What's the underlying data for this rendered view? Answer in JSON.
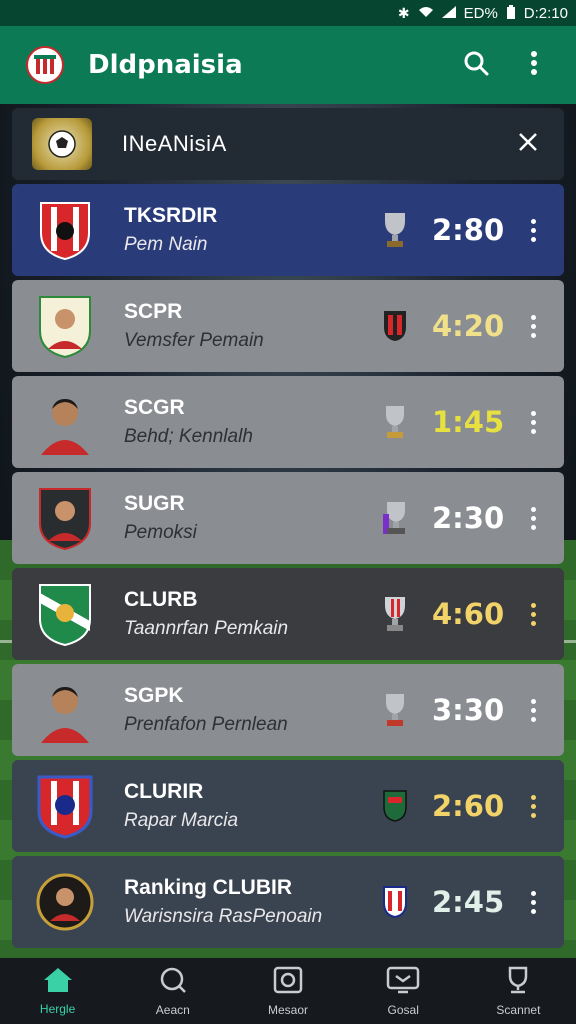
{
  "status_bar": {
    "indicator": "ED%",
    "time": "D:2:10",
    "icons": [
      "bluetooth-icon",
      "wifi-icon",
      "signal-icon",
      "battery-icon"
    ]
  },
  "app_bar": {
    "title": "Dldpnaisia",
    "actions": [
      "search-icon",
      "more-vertical-icon"
    ]
  },
  "header": {
    "title": "INeANisiA",
    "close_icon": "close-icon"
  },
  "list": [
    {
      "title": "TKSRDIR",
      "subtitle": "Pem Nain",
      "time": "2:80",
      "theme": "blue",
      "time_color": "#ffffff"
    },
    {
      "title": "SCPR",
      "subtitle": "Vemsfer Pemain",
      "time": "4:20",
      "theme": "gray",
      "time_color": "#f0e08a"
    },
    {
      "title": "SCGR",
      "subtitle": "Behd; Kennlalh",
      "time": "1:45",
      "theme": "gray",
      "time_color": "#e6e040"
    },
    {
      "title": "SUGR",
      "subtitle": "Pemoksi",
      "time": "2:30",
      "theme": "gray",
      "time_color": "#ffffff"
    },
    {
      "title": "CLURB",
      "subtitle": "Taannrfan Pemkain",
      "time": "4:60",
      "theme": "dark",
      "time_color": "#f2d36a"
    },
    {
      "title": "SGPK",
      "subtitle": "Prenfafon Pernlean",
      "time": "3:30",
      "theme": "gray",
      "time_color": "#ffffff"
    },
    {
      "title": "CLURIR",
      "subtitle": "Rapar Marcia",
      "time": "2:60",
      "theme": "darkblue",
      "time_color": "#f2d36a"
    },
    {
      "title": "Ranking CLUBIR",
      "subtitle": "Warisnsira RasPenoain",
      "time": "2:45",
      "theme": "darkblue",
      "time_color": "#e0f0e8"
    }
  ],
  "bottom_nav": [
    {
      "label": "Hergle",
      "icon": "home-icon",
      "active": true
    },
    {
      "label": "Aeacn",
      "icon": "search-icon",
      "active": false
    },
    {
      "label": "Mesaor",
      "icon": "camera-icon",
      "active": false
    },
    {
      "label": "Gosal",
      "icon": "tv-icon",
      "active": false
    },
    {
      "label": "Scannet",
      "icon": "trophy-icon",
      "active": false
    }
  ],
  "colors": {
    "status_bar": "#06452f",
    "app_bar": "#0b7a55",
    "accent": "#3ad1a6"
  }
}
